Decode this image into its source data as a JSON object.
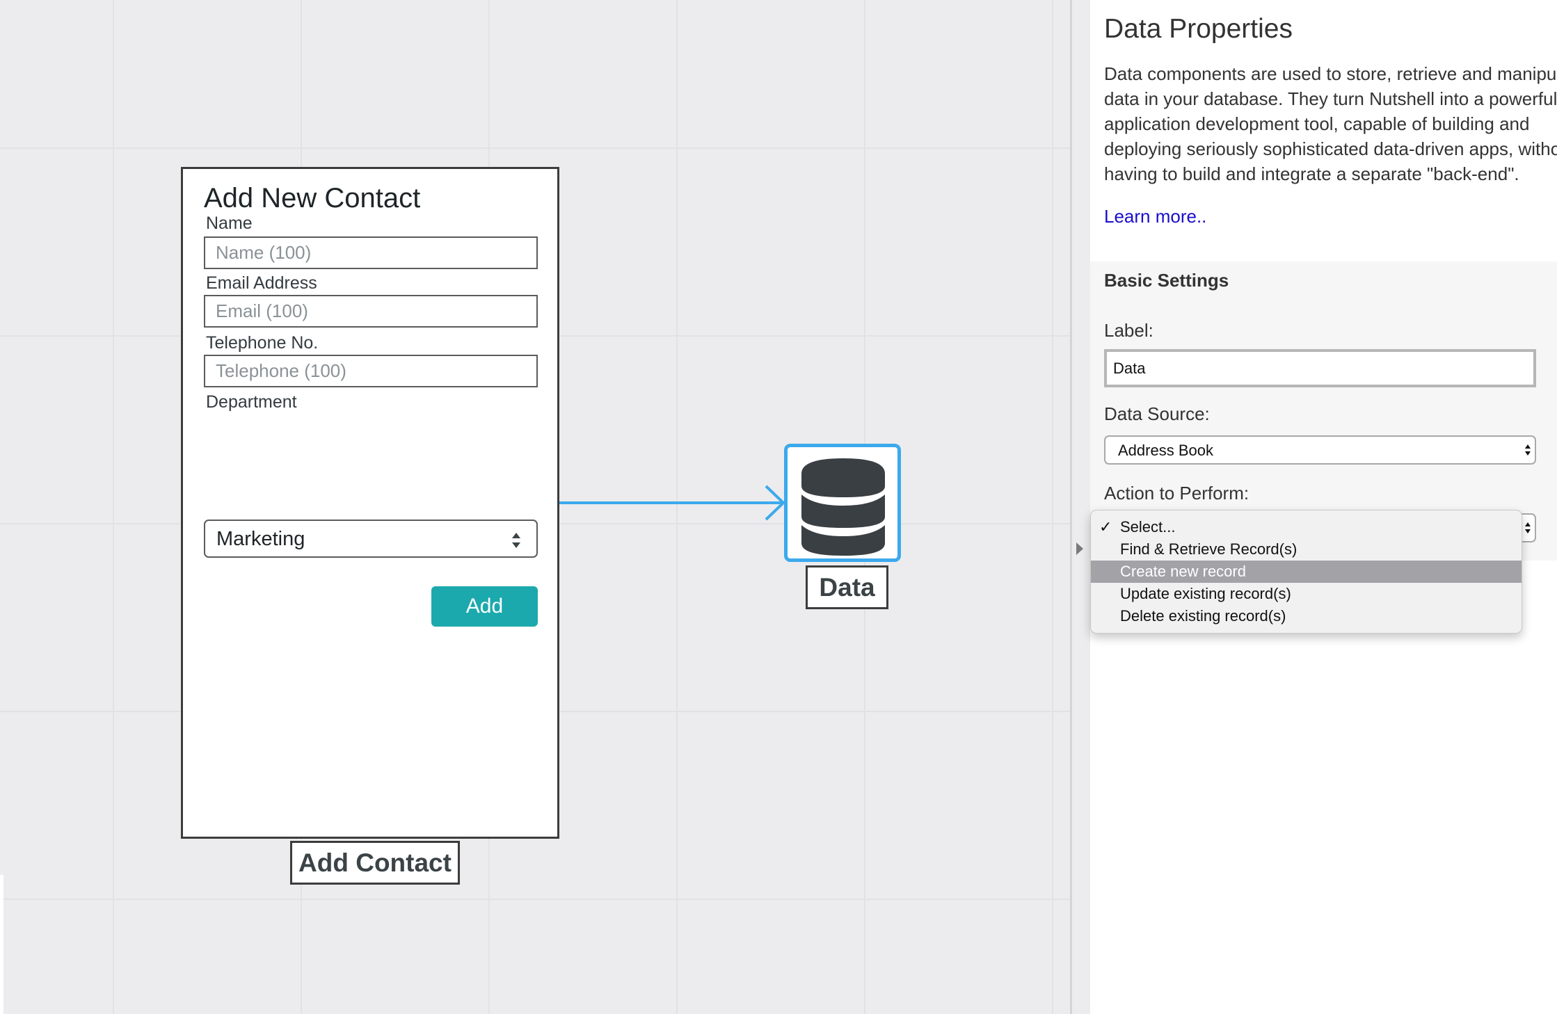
{
  "form_node": {
    "title": "Add New Contact",
    "fields": [
      {
        "label": "Name",
        "placeholder": "Name (100)"
      },
      {
        "label": "Email Address",
        "placeholder": "Email (100)"
      },
      {
        "label": "Telephone No.",
        "placeholder": "Telephone (100)"
      }
    ],
    "department": {
      "label": "Department",
      "value": "Marketing"
    },
    "add_button_label": "Add",
    "caption": "Add Contact"
  },
  "connector": {
    "color": "#3ca9ec"
  },
  "data_node": {
    "icon": "database-icon",
    "caption": "Data",
    "border_color": "#3ca9ec"
  },
  "panel": {
    "title": "Data Properties",
    "description": "Data components are used to store, retrieve and manipulate data in your database. They turn Nutshell into a powerful rapid application development tool, capable of building and deploying seriously sophisticated data-driven apps, without having to build and integrate a separate \"back-end\".",
    "learn_more": "Learn more..",
    "basic_settings": {
      "title": "Basic Settings",
      "label_label": "Label:",
      "label_value": "Data",
      "source_label": "Data Source:",
      "source_value": "Address Book",
      "action_label": "Action to Perform:"
    },
    "action_menu": {
      "items": [
        "Select...",
        "Find & Retrieve Record(s)",
        "Create new record",
        "Update existing record(s)",
        "Delete existing record(s)"
      ],
      "checked_item": "Select...",
      "highlighted_item": "Create new record"
    }
  },
  "colors": {
    "accent_button": "#1ca9ad",
    "link": "#1a0dcc",
    "menu_highlight": "#a2a2a7"
  }
}
